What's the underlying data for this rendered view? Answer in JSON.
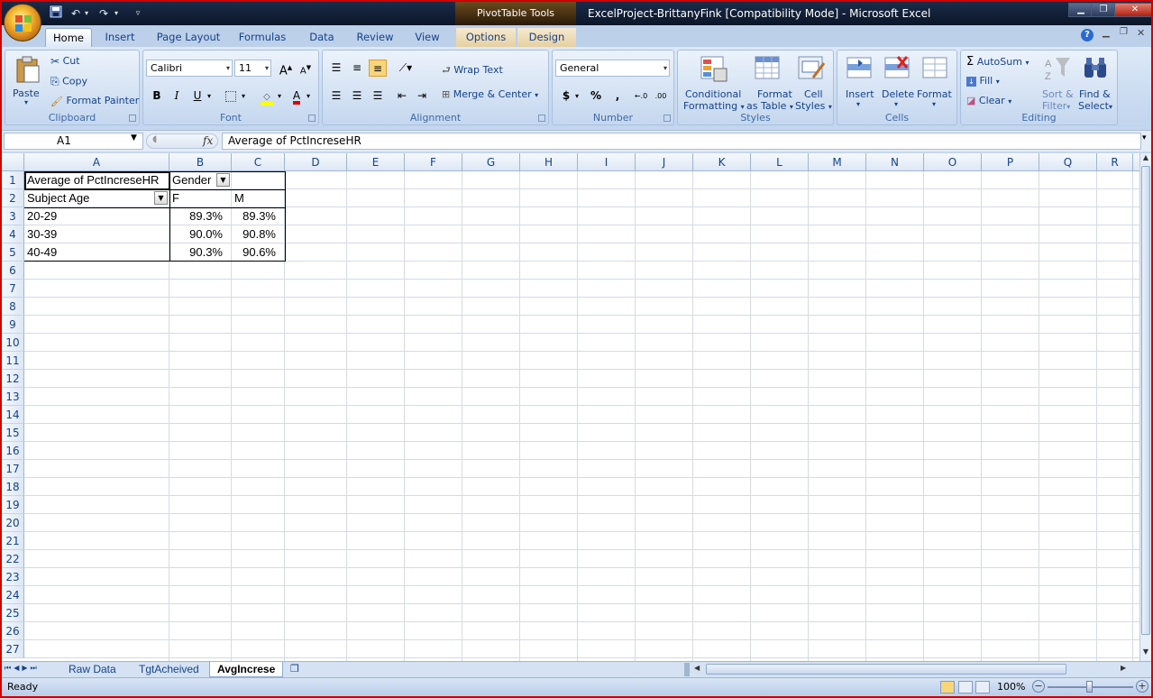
{
  "window": {
    "title": "ExcelProject-BrittanyFink  [Compatibility Mode] - Microsoft Excel",
    "contextual_tab_group": "PivotTable Tools"
  },
  "quick_access": [
    "save-icon",
    "undo-icon",
    "redo-icon",
    "customize-icon"
  ],
  "tabs": [
    "Home",
    "Insert",
    "Page Layout",
    "Formulas",
    "Data",
    "Review",
    "View",
    "Options",
    "Design"
  ],
  "ribbon": {
    "clipboard": {
      "label": "Clipboard",
      "paste": "Paste",
      "cut": "Cut",
      "copy": "Copy",
      "format_painter": "Format Painter"
    },
    "font": {
      "label": "Font",
      "family": "Calibri",
      "size": "11"
    },
    "alignment": {
      "label": "Alignment",
      "wrap": "Wrap Text",
      "merge": "Merge & Center"
    },
    "number": {
      "label": "Number",
      "format": "General"
    },
    "styles": {
      "label": "Styles",
      "conditional": "Conditional",
      "conditional2": "Formatting",
      "format_table": "Format",
      "format_table2": "as Table",
      "cell_styles": "Cell",
      "cell_styles2": "Styles"
    },
    "cells": {
      "label": "Cells",
      "insert": "Insert",
      "delete": "Delete",
      "format": "Format"
    },
    "editing": {
      "label": "Editing",
      "autosum": "AutoSum",
      "fill": "Fill",
      "clear": "Clear",
      "sort": "Sort &",
      "sort2": "Filter",
      "find": "Find &",
      "find2": "Select"
    }
  },
  "formula_bar": {
    "name_box": "A1",
    "fx": "fx",
    "formula": "Average of PctIncreseHR"
  },
  "columns": [
    "A",
    "B",
    "C",
    "D",
    "E",
    "F",
    "G",
    "H",
    "I",
    "J",
    "K",
    "L",
    "M",
    "N",
    "O",
    "P",
    "Q",
    "R"
  ],
  "rows": [
    "1",
    "2",
    "3",
    "4",
    "5",
    "6",
    "7",
    "8",
    "9",
    "10",
    "11",
    "12",
    "13",
    "14",
    "15",
    "16",
    "17",
    "18",
    "19",
    "20",
    "21",
    "22",
    "23",
    "24",
    "25",
    "26",
    "27"
  ],
  "pivot": {
    "a1": "Average of PctIncreseHR",
    "b1": "Gender",
    "a2": "Subject Age",
    "b2": "F",
    "c2": "M",
    "rows": [
      {
        "age": "20-29",
        "f": "89.3%",
        "m": "89.3%"
      },
      {
        "age": "30-39",
        "f": "90.0%",
        "m": "90.8%"
      },
      {
        "age": "40-49",
        "f": "90.3%",
        "m": "90.6%"
      }
    ]
  },
  "sheets": [
    "Raw Data",
    "TgtAcheived",
    "AvgIncrese"
  ],
  "active_sheet": "AvgIncrese",
  "status": {
    "mode": "Ready",
    "zoom": "100%"
  }
}
